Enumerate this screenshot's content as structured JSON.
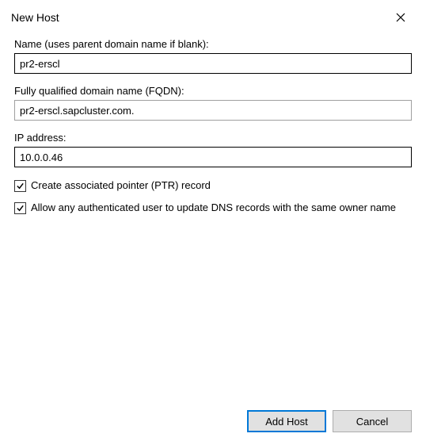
{
  "title": "New Host",
  "fields": {
    "name": {
      "label": "Name (uses parent domain name if blank):",
      "value": "pr2-erscl"
    },
    "fqdn": {
      "label": "Fully qualified domain name (FQDN):",
      "value": "pr2-erscl.sapcluster.com."
    },
    "ip": {
      "label": "IP address:",
      "value": "10.0.0.46"
    }
  },
  "checkboxes": {
    "ptr": {
      "label": "Create associated pointer (PTR) record",
      "checked": true
    },
    "allow_update": {
      "label": "Allow any authenticated user to update DNS records with the same owner name",
      "checked": true
    }
  },
  "buttons": {
    "add_host": "Add Host",
    "cancel": "Cancel"
  }
}
